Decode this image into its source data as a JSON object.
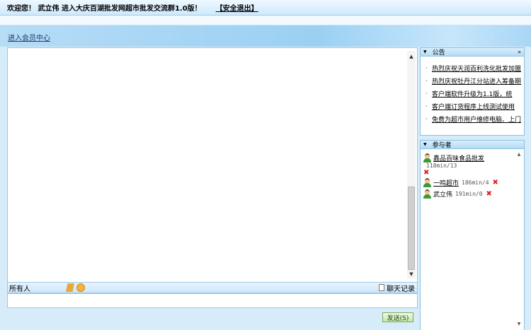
{
  "header": {
    "welcome_text": "欢迎您！ 武立伟 进入大庆百湖批发网超市批发交流群1.0版！",
    "logout_label": "【安全退出】"
  },
  "nav": {
    "member_center_label": "进入会员中心"
  },
  "chat": {
    "recipient_label": "所有人",
    "history_label": "聊天记录",
    "send_label": "发送(S)"
  },
  "announcements": {
    "title": "公告",
    "more_icon": "»",
    "items": [
      {
        "text": "热烈庆祝天润百利洗化批发加盟"
      },
      {
        "text": "热烈庆祝牡丹江分站进入筹备期"
      },
      {
        "text": "客户端软件升级为1.1版，统"
      },
      {
        "text": "客户端订货程序上线测试使用"
      },
      {
        "text": "免费为超市用户维修电脑、上门"
      }
    ]
  },
  "participants": {
    "title": "参与者",
    "list": [
      {
        "name": "鑫品百味食品批发",
        "stat": "118min/13"
      },
      {
        "name": "一鸣超市",
        "stat": "186min/4"
      },
      {
        "name": "武立伟",
        "stat": "191min/0"
      }
    ]
  },
  "icons": {
    "kick": "✖",
    "scroll_up": "▲",
    "scroll_down": "▼",
    "collapse": "▼"
  }
}
